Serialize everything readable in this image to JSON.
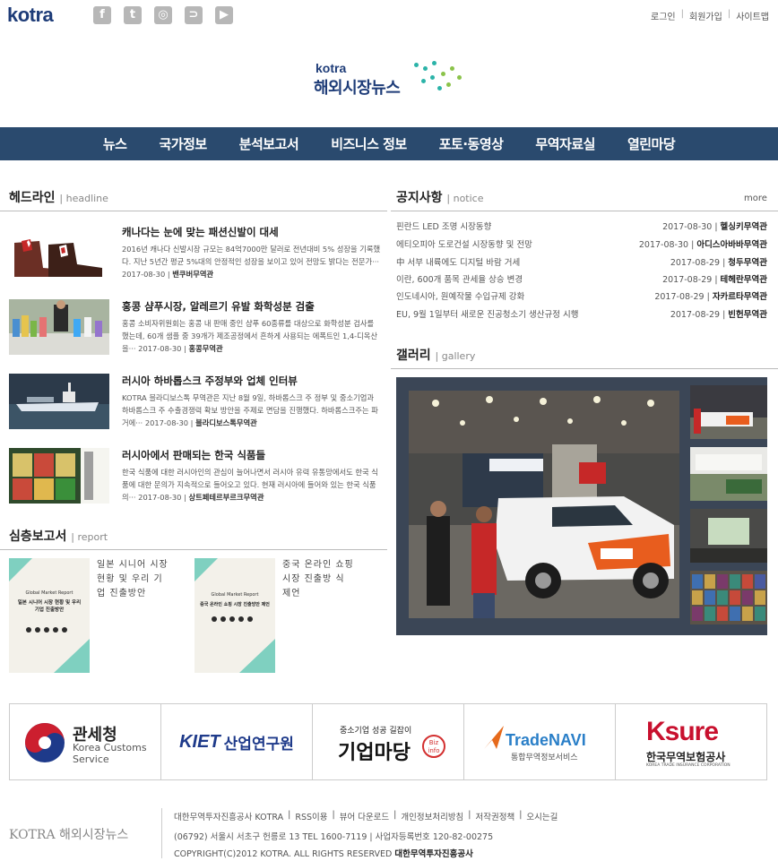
{
  "header": {
    "brand": "kotra",
    "social": [
      {
        "icon": "facebook-icon",
        "glyph": "f"
      },
      {
        "icon": "twitter-icon",
        "glyph": "t"
      },
      {
        "icon": "instagram-icon",
        "glyph": "◎"
      },
      {
        "icon": "rss-icon",
        "glyph": "⊃"
      },
      {
        "icon": "youtube-icon",
        "glyph": "▶"
      }
    ],
    "links": [
      "로그인",
      "회원가입",
      "사이트맵"
    ],
    "logo_top": "kotra",
    "logo_title": "해외시장뉴스"
  },
  "nav": [
    "뉴스",
    "국가정보",
    "분석보고서",
    "비즈니스 정보",
    "포토·동영상",
    "무역자료실",
    "열린마당"
  ],
  "headline": {
    "title": "헤드라인",
    "title_en": "headline",
    "items": [
      {
        "title": "캐나다는 눈에 맞는 패션신발이 대세",
        "body": "2016년 캐나다 신발시장 규모는 84억7000만 달러로 전년대비 5% 성장을 기록했다. 지난 5년간 평균 5%대의 안정적인 성장을 보이고 있어 전망도 밝다는 전문가··· 2017-08-30 |",
        "office": "밴쿠버무역관"
      },
      {
        "title": "홍콩 샴푸시장, 알레르기 유발 화학성분 검출",
        "body": "홍콩 소비자위원회는 홍콩 내 판매 중인 샴푸 60종류를 대상으로 화학성분 검사를 했는데, 60개 샘플 중 39개가 제조공정에서 흔하게 사용되는 에폭트인 1,4-디옥산을··· 2017-08-30 |",
        "office": "홍콩무역관"
      },
      {
        "title": "러시아 하바롭스크 주정부와 업체 인터뷰",
        "body": "KOTRA 블라디보스톡 무역관은 지난 8월 9일, 하바롭스크 주 정부 및 중소기업과 하바롭스크 주 수출경쟁력 확보 방안을 주제로 면담을 진행했다. 하바롭스크주는 파거에··· 2017-08-30 |",
        "office": "블라디보스톡무역관"
      },
      {
        "title": "러시아에서 판매되는 한국 식품들",
        "body": "한국 식품에 대한 러시아인의 관심이 늘어나면서 러시아 유력 유통망에서도 한국 식품에 대한 문의가 지속적으로 들어오고 있다. 현재 러시아에 들어와 있는 한국 식품의··· 2017-08-30 |",
        "office": "상트페테르부르크무역관"
      }
    ]
  },
  "notice": {
    "title": "공지사항",
    "title_en": "notice",
    "more": "more",
    "items": [
      {
        "title": "핀란드 LED 조명 시장동향",
        "date": "2017-08-30",
        "office": "헬싱키무역관"
      },
      {
        "title": "에티오피아 도로건설 시장동향 및 전망",
        "date": "2017-08-30",
        "office": "아디스아바바무역관"
      },
      {
        "title": "中 서부 내륙에도 디지털 바람 거세",
        "date": "2017-08-29",
        "office": "청두무역관"
      },
      {
        "title": "이란, 600개 품목 관세율 상승 변경",
        "date": "2017-08-29",
        "office": "테헤란무역관"
      },
      {
        "title": "인도네시아, 원예작물 수입규제 강화",
        "date": "2017-08-29",
        "office": "자카르타무역관"
      },
      {
        "title": "EU, 9월 1일부터 새로운 진공청소기 생산규정 시행",
        "date": "2017-08-29",
        "office": "빈헌무역관"
      }
    ]
  },
  "gallery": {
    "title": "갤러리",
    "title_en": "gallery"
  },
  "report": {
    "title": "심층보고서",
    "title_en": "report",
    "items": [
      {
        "cover_label": "Global Market Report",
        "cover_title": "일본 시니어 시장 현황 및 우리기업 진출방안",
        "text": "일본 시니어 시장 현황 및 우리 기업 진출방안"
      },
      {
        "cover_label": "Global Market Report",
        "cover_title": "중국 온라인 쇼핑 시장 진출방안 제언",
        "text": "중국 온라인 쇼핑 시장 진출방 식 제언"
      }
    ]
  },
  "partners": [
    {
      "name": "관세청",
      "sub": "Korea Customs Service"
    },
    {
      "name": "산업연구원",
      "sub": "KIET"
    },
    {
      "name": "기업마당",
      "sub": "중소기업 성공 길잡이",
      "badge": "Biz info"
    },
    {
      "name": "TradeNAVI",
      "sub": "통합무역정보서비스"
    },
    {
      "name": "Ksure",
      "sub": "한국무역보험공사",
      "sub2": "KOREA TRADE INSURANCE CORPORATION"
    }
  ],
  "footer": {
    "logo": "KOTRA 해외시장뉴스",
    "links": [
      "대한무역투자진흥공사 KOTRA",
      "RSS이용",
      "뷰어 다운로드",
      "개인정보처리방침",
      "저작권정책",
      "오시는길"
    ],
    "address": "(06792) 서울시 서초구 헌릉로 13 TEL 1600-7119 | 사업자등록번호 120-82-00275",
    "copyright": "COPYRIGHT(C)2012 KOTRA. ALL RIGHTS RESERVED",
    "copyright_org": "대한무역투자진흥공사"
  },
  "colors": {
    "nav_bg": "#2a4a6e",
    "brand": "#1e3c78",
    "gallery_bg": "#3b4656"
  }
}
